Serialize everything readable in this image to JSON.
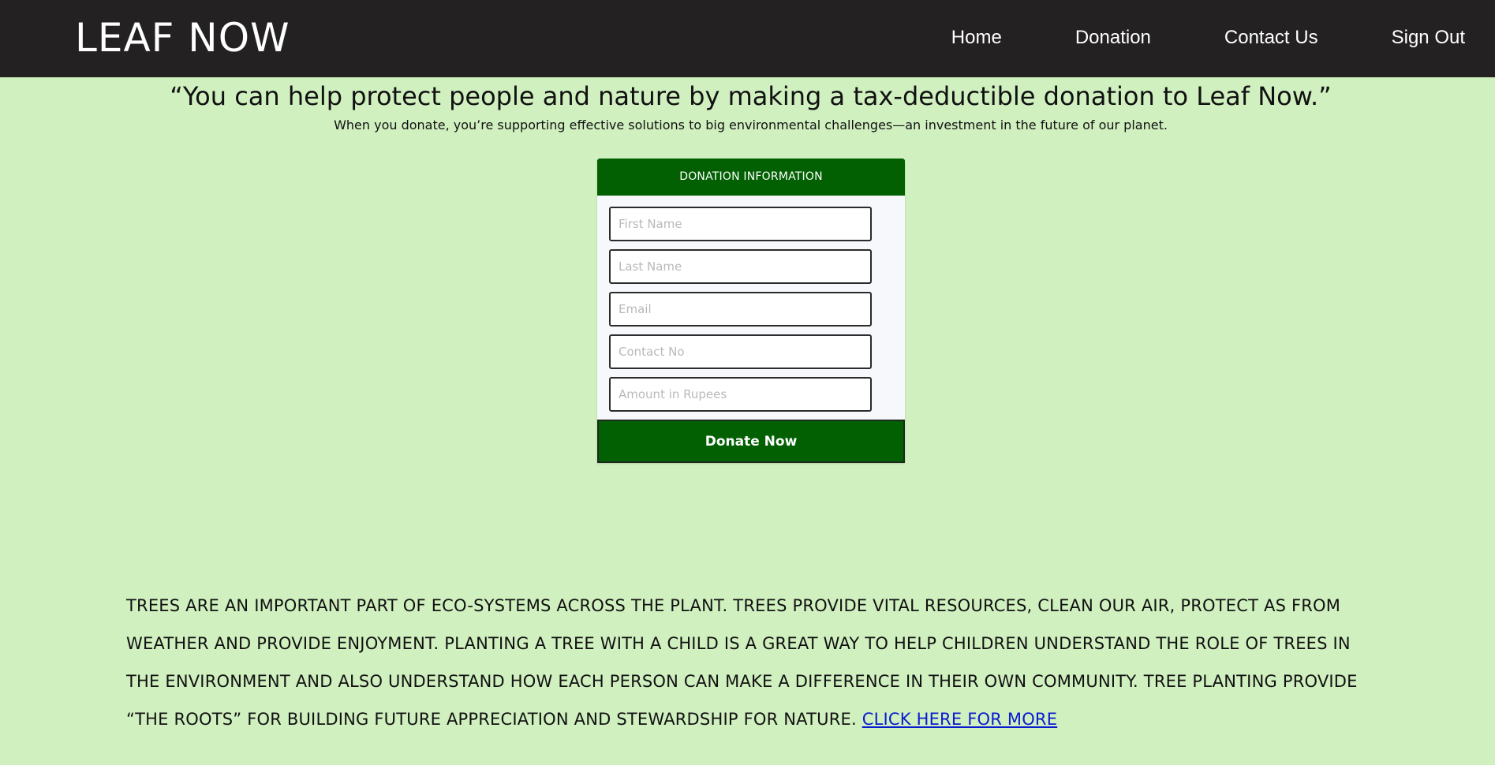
{
  "header": {
    "logo": "LEAF NOW",
    "nav": [
      {
        "label": "Home"
      },
      {
        "label": "Donation"
      },
      {
        "label": "Contact Us"
      },
      {
        "label": "Sign Out"
      }
    ]
  },
  "hero": {
    "quote": "“You can help protect people and nature by making a tax-deductible donation to Leaf Now.”",
    "subtext": "When you donate, you’re supporting effective solutions to big environmental challenges—an investment in the future of our planet."
  },
  "donation_form": {
    "title": "DONATION INFORMATION",
    "fields": [
      {
        "placeholder": "First Name",
        "value": ""
      },
      {
        "placeholder": "Last Name",
        "value": ""
      },
      {
        "placeholder": "Email",
        "value": ""
      },
      {
        "placeholder": "Contact No",
        "value": ""
      },
      {
        "placeholder": "Amount in Rupees",
        "value": ""
      }
    ],
    "submit_label": "Donate Now"
  },
  "info": {
    "text": "TREES ARE AN IMPORTANT PART OF ECO-SYSTEMS ACROSS THE PLANT. TREES PROVIDE VITAL RESOURCES, CLEAN OUR AIR, PROTECT AS FROM WEATHER AND PROVIDE ENJOYMENT. PLANTING A TREE WITH A CHILD IS A GREAT WAY TO HELP CHILDREN UNDERSTAND THE ROLE OF TREES IN THE ENVIRONMENT AND ALSO UNDERSTAND HOW EACH PERSON CAN MAKE A DIFFERENCE IN THEIR OWN COMMUNITY. TREE PLANTING PROVIDE “THE ROOTS” FOR BUILDING FUTURE APPRECIATION AND STEWARDSHIP FOR NATURE.",
    "link_label": "CLICK HERE FOR MORE"
  },
  "colors": {
    "background": "#d0f0c0",
    "header": "#232122",
    "accent_green": "#026003",
    "link": "#0b1bd0"
  }
}
